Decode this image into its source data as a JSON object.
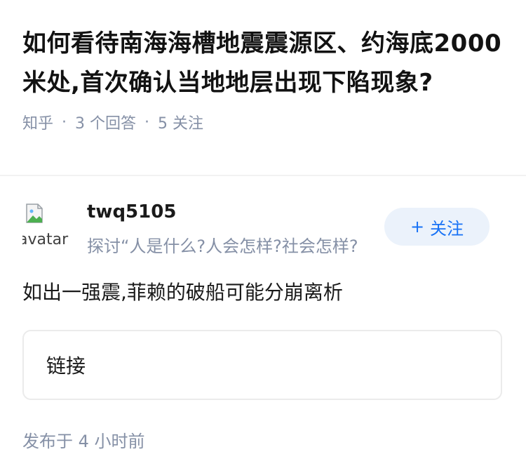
{
  "question": {
    "title": "如何看待南海海槽地震震源区、约海底2000米处,首次确认当地地层出现下陷现象?",
    "source": "知乎",
    "answers_count_text": "3 个回答",
    "followers_count_text": "5 关注"
  },
  "answer": {
    "author": {
      "avatar_alt": "avatar",
      "name": "twq5105",
      "bio": "探讨“人是什么?人会怎样?社会怎样?"
    },
    "follow_button": {
      "plus": "+",
      "label": "关注"
    },
    "content": "如出一强震,菲赖的破船可能分崩离析",
    "link_card": {
      "label": "链接"
    },
    "publish_time": "发布于 4 小时前"
  },
  "colors": {
    "accent": "#1772f6",
    "follow_bg": "#ebf2fb",
    "meta_gray": "#8590a6"
  },
  "icons": {
    "avatar_broken": "broken-image-icon"
  }
}
